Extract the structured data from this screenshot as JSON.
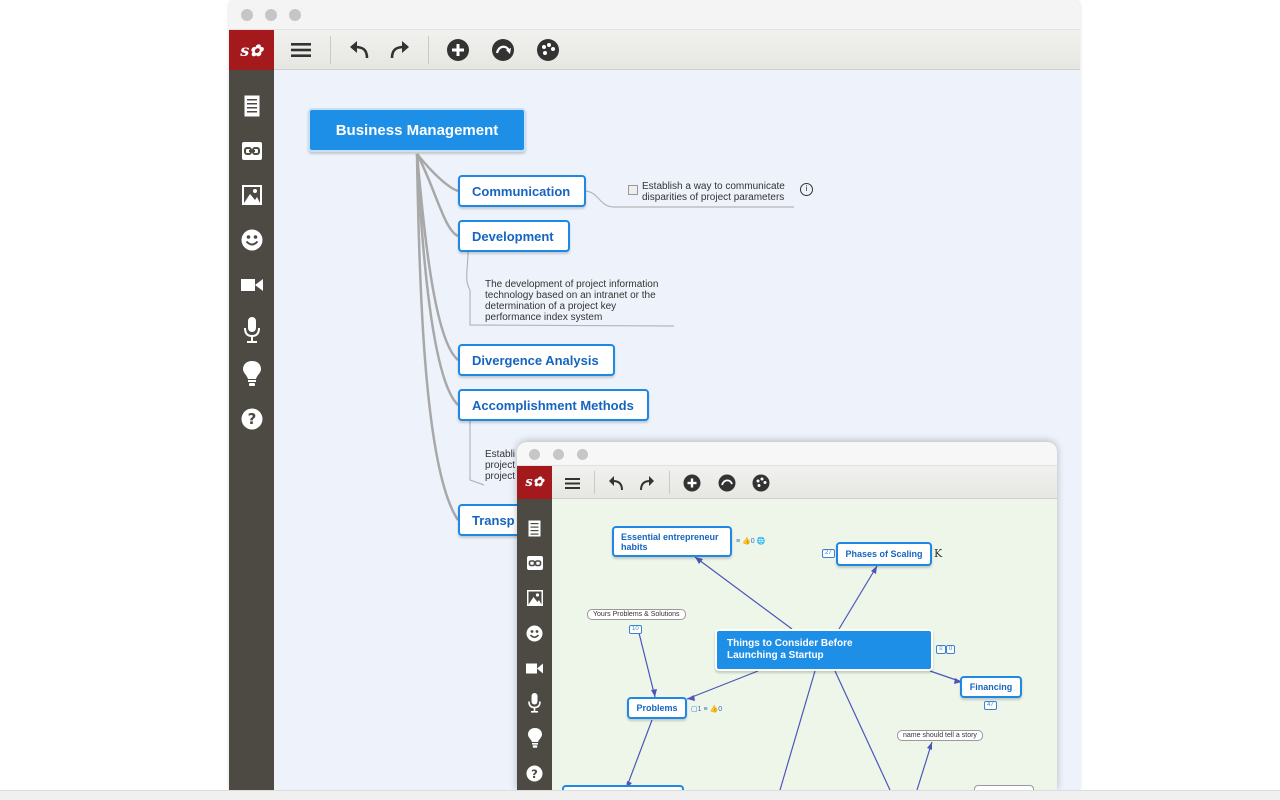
{
  "app": {
    "logo_text": "s✿"
  },
  "main_window": {
    "toolbar": {
      "menu_icon": "hamburger-icon",
      "undo_icon": "undo-icon",
      "redo_icon": "redo-icon",
      "add_icon": "add-circle-icon",
      "link_icon": "curve-link-icon",
      "palette_icon": "palette-icon"
    },
    "sidebar": [
      "notes-icon",
      "link-icon",
      "image-icon",
      "emoji-icon",
      "video-icon",
      "microphone-icon",
      "lightbulb-icon",
      "help-icon"
    ],
    "map": {
      "root": "Business Management",
      "topics": [
        {
          "label": "Communication"
        },
        {
          "label": "Development"
        },
        {
          "label": "Divergence Analysis"
        },
        {
          "label": "Accomplishment Methods"
        },
        {
          "label": "Transp"
        }
      ],
      "communication_note": "Establish a way to communicate\ndisparities of project parameters",
      "development_note": "The development of project information\ntechnology based on an intranet or the\ndetermination of a project key\nperformance index system",
      "accomplishment_note": "Establi\nproject\nproject"
    }
  },
  "sub_window": {
    "map": {
      "root": "Things to Consider Before\nLaunching a Startup",
      "root_meta": "0",
      "habits": "Essential entrepreneur\nhabits",
      "habits_meta": "≡ 👍0 🌐",
      "scaling": "Phases of Scaling",
      "scaling_badge": "27",
      "scaling_suffix": "K",
      "financing": "Financing",
      "financing_badge": "47",
      "problems": "Problems",
      "problems_meta": "▢1  ≡  👍0",
      "yours_problems": "Yours Problems & Solutions",
      "yours_badge": "10",
      "story": "name should tell a story"
    }
  },
  "colors": {
    "accent": "#1e88e5",
    "logo_red": "#a3191c",
    "sidebar": "#4c4a43"
  }
}
